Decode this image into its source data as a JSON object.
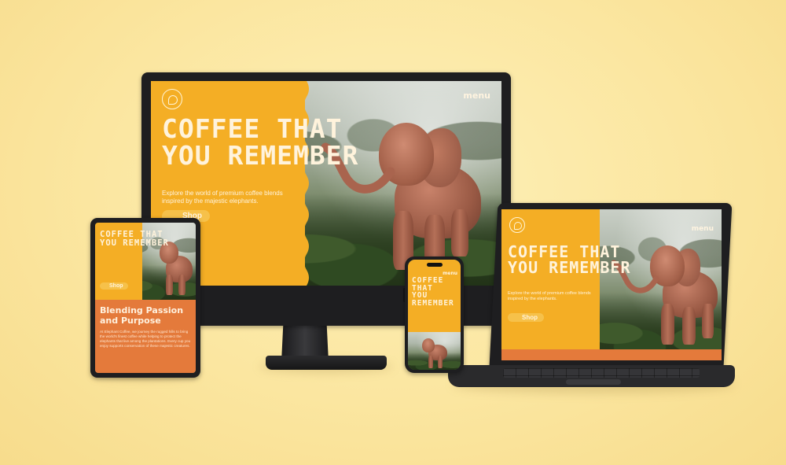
{
  "hero": {
    "headline": "COFFEE THAT\nYOU REMEMBER",
    "subtitle": "Explore the world of premium coffee blends inspired by the majestic elephants.",
    "shop_label": "Shop",
    "menu_label": "menu"
  },
  "tablet": {
    "headline": "COFFEE THAT\nYOU REMEMBER",
    "shop_label": "Shop",
    "section_title": "Blending Passion\nand Purpose",
    "section_body": "At Elephant Coffee, we journey the rugged hills to bring the world's finest coffee while helping to protect the elephants that live among the plantations. Every cup you enjoy supports conservation of these majestic creatures."
  },
  "phone": {
    "headline": "COFFEE THAT\nYOU\nREMEMBER",
    "menu_label": "menu"
  },
  "laptop": {
    "headline": "COFFEE THAT\nYOU REMEMBER",
    "subtitle": "Explore the world of premium coffee blends inspired by the elephants.",
    "shop_label": "Shop",
    "menu_label": "menu"
  },
  "colors": {
    "background": "#fbe7a0",
    "panel_yellow": "#f4ae25",
    "accent_orange": "#e47a3b",
    "device_black": "#1e1e20"
  }
}
